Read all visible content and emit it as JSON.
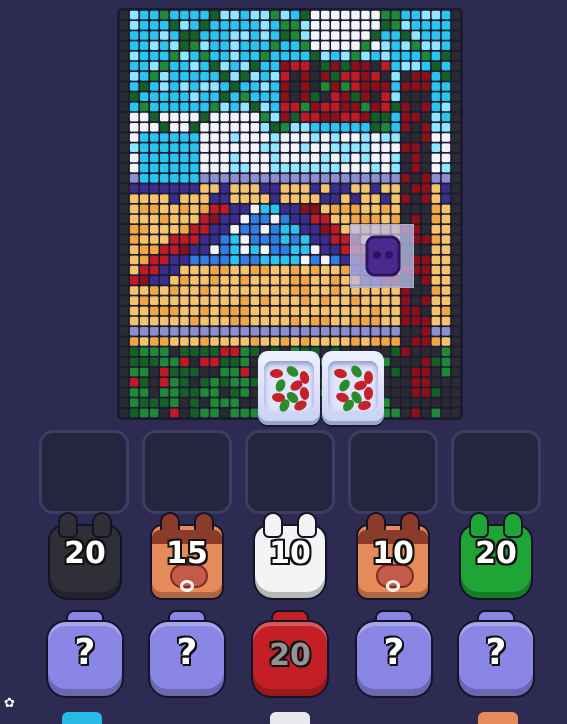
{
  "board": {
    "palette": {
      "cyan": "#28c6ee",
      "lightblue": "#8fe6ff",
      "white": "#f2f4f8",
      "green": "#1f8a35",
      "darkgreen": "#146125",
      "black": "#2a2a33",
      "red": "#c21a23",
      "darkred": "#8d0f18",
      "lavender": "#8b8fd0",
      "navy": "#3a2d8e",
      "purple": "#5a2a9a",
      "sand": "#f5c36a",
      "orange": "#f0a742",
      "blue": "#2f7fe3",
      "grey": "#7c7c8c"
    },
    "blocker_icon": "purple-block-icon",
    "trays": [
      {
        "name": "bean-tray-left",
        "icon": "red-green-beans-icon"
      },
      {
        "name": "bean-tray-right",
        "icon": "red-green-beans-icon"
      }
    ]
  },
  "slots": [
    {
      "name": "slot-1"
    },
    {
      "name": "slot-2"
    },
    {
      "name": "slot-3"
    },
    {
      "name": "slot-4"
    },
    {
      "name": "slot-5"
    }
  ],
  "row1": [
    {
      "kind": "jar",
      "color": "#2f2f37",
      "count": "20",
      "name": "black-jar"
    },
    {
      "kind": "pig",
      "color": "#e58a59",
      "count": "15",
      "name": "pig-jar-orange"
    },
    {
      "kind": "jar",
      "color": "#f4f4f6",
      "count": "10",
      "name": "white-jar"
    },
    {
      "kind": "pig",
      "color": "#e58a59",
      "count": "10",
      "name": "pig-jar-orange-2"
    },
    {
      "kind": "jar",
      "color": "#1ea535",
      "count": "20",
      "name": "green-jar"
    }
  ],
  "row2": [
    {
      "kind": "mystery",
      "color": "#8a86e6",
      "label": "?",
      "name": "mystery-bottle-1"
    },
    {
      "kind": "mystery",
      "color": "#8a86e6",
      "label": "?",
      "name": "mystery-bottle-2"
    },
    {
      "kind": "bottle",
      "color": "#c41f26",
      "label": "20",
      "name": "red-bottle"
    },
    {
      "kind": "mystery",
      "color": "#8a86e6",
      "label": "?",
      "name": "mystery-bottle-3"
    },
    {
      "kind": "mystery",
      "color": "#8a86e6",
      "label": "?",
      "name": "mystery-bottle-4"
    }
  ]
}
